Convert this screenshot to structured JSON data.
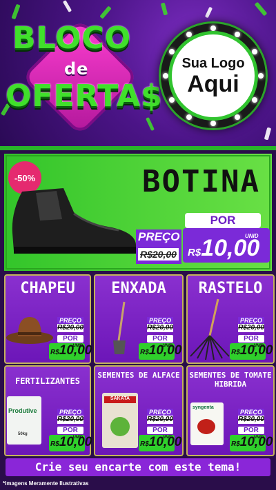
{
  "brand": {
    "line1": "BLOCO",
    "line2": "de",
    "line3": "OFERTA$"
  },
  "logo": {
    "line1": "Sua Logo",
    "line2": "Aqui"
  },
  "hero": {
    "badge": "-50%",
    "title": "BOTINA",
    "price_label": "PREÇO",
    "old_price": "R$20,00",
    "por_label": "POR",
    "unit_label": "UNID",
    "currency": "R$",
    "new_price": "10,00"
  },
  "products": [
    {
      "title": "CHAPEU",
      "price_label": "PREÇO",
      "old": "R$20,00",
      "por": "POR",
      "unid": "UNID",
      "currency": "R$",
      "price": "10,00"
    },
    {
      "title": "ENXADA",
      "price_label": "PREÇO",
      "old": "R$20,00",
      "por": "POR",
      "unid": "UNID",
      "currency": "R$",
      "price": "10,00"
    },
    {
      "title": "RASTELO",
      "price_label": "PREÇO",
      "old": "R$20,00",
      "por": "POR",
      "unid": "UNID",
      "currency": "R$",
      "price": "10,00"
    },
    {
      "title": "FERTILIZANTES",
      "price_label": "PREÇO",
      "old": "R$20,00",
      "por": "POR",
      "unid": "UNID",
      "currency": "R$",
      "price": "10,00"
    },
    {
      "title": "SEMENTES DE ALFACE",
      "price_label": "PREÇO",
      "old": "R$20,00",
      "por": "POR",
      "unid": "UNID",
      "currency": "R$",
      "price": "10,00"
    },
    {
      "title": "SEMENTES DE TOMATE HIBRIDA",
      "price_label": "PREÇO",
      "old": "R$20,00",
      "por": "POR",
      "unid": "UNID",
      "currency": "R$",
      "price": "10,00"
    }
  ],
  "product_images": {
    "fert_brand": "Produtive",
    "fert_weight": "50kg",
    "alface_brand": "SAKATA",
    "tomate_brand": "syngenta"
  },
  "cta": "Crie seu encarte com este tema!",
  "footnote": "*Imagens Meramente Ilustrativas",
  "colors": {
    "purple": "#7b2ad8",
    "green": "#33c52a",
    "pink": "#e52a6f"
  }
}
